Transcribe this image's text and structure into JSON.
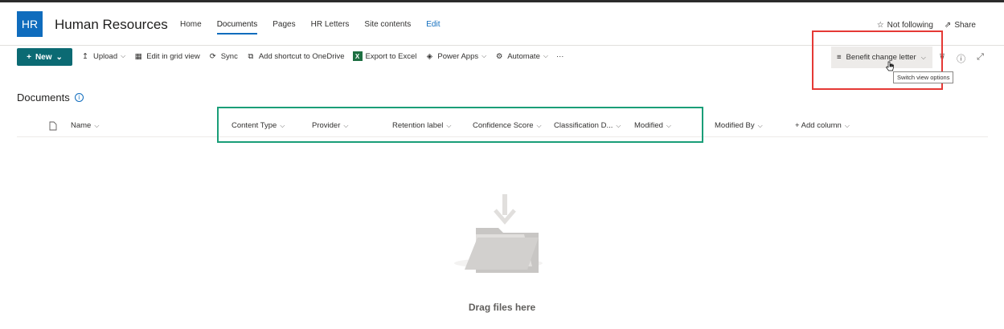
{
  "site": {
    "logo": "HR",
    "title": "Human Resources",
    "nav": [
      "Home",
      "Documents",
      "Pages",
      "HR Letters",
      "Site contents",
      "Edit"
    ],
    "actions": {
      "follow": "Not following",
      "share": "Share"
    }
  },
  "commandbar": {
    "new_label": "New",
    "items": [
      "Upload",
      "Edit in grid view",
      "Sync",
      "Add shortcut to OneDrive",
      "Export to Excel",
      "Power Apps",
      "Automate"
    ],
    "view_label": "Benefit change letter",
    "tooltip": "Switch view options"
  },
  "library": {
    "title": "Documents",
    "columns": [
      "Name",
      "Content Type",
      "Provider",
      "Retention label",
      "Confidence Score",
      "Classification D...",
      "Modified",
      "Modified By",
      "+ Add column"
    ]
  },
  "empty_state": {
    "text": "Drag files here"
  },
  "colors": {
    "brand": "#0f6cbd",
    "new_button": "#0b6a73",
    "highlight_red": "#e53935",
    "highlight_green": "#1a9e78"
  }
}
